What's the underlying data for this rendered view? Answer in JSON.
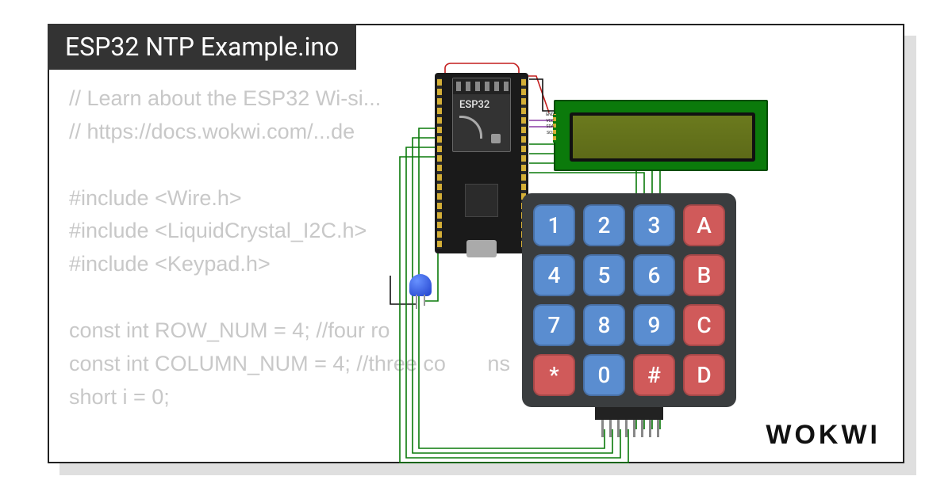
{
  "title": "ESP32 NTP Example.ino",
  "code": {
    "line1": "// Learn about the ESP32 Wi-si...",
    "line2": "// https://docs.wokwi.com/...de",
    "line3": "",
    "line4": "#include <Wire.h>",
    "line5": "#include <LiquidCrystal_I2C.h>",
    "line6": "#include <Keypad.h>",
    "line7": "",
    "line8": "const int ROW_NUM = 4; //four ro",
    "line9": "const int COLUMN_NUM = 4; //three co       ns",
    "line10": "short i = 0;"
  },
  "logo": "WOKWI",
  "esp32": {
    "label": "ESP32"
  },
  "lcd": {
    "pins": [
      "GND",
      "VCC",
      "SDA",
      "SCL"
    ]
  },
  "keypad": {
    "keys": [
      {
        "label": "1",
        "color": "blue"
      },
      {
        "label": "2",
        "color": "blue"
      },
      {
        "label": "3",
        "color": "blue"
      },
      {
        "label": "A",
        "color": "red"
      },
      {
        "label": "4",
        "color": "blue"
      },
      {
        "label": "5",
        "color": "blue"
      },
      {
        "label": "6",
        "color": "blue"
      },
      {
        "label": "B",
        "color": "red"
      },
      {
        "label": "7",
        "color": "blue"
      },
      {
        "label": "8",
        "color": "blue"
      },
      {
        "label": "9",
        "color": "blue"
      },
      {
        "label": "C",
        "color": "red"
      },
      {
        "label": "*",
        "color": "red"
      },
      {
        "label": "0",
        "color": "blue"
      },
      {
        "label": "#",
        "color": "red"
      },
      {
        "label": "D",
        "color": "red"
      }
    ]
  }
}
